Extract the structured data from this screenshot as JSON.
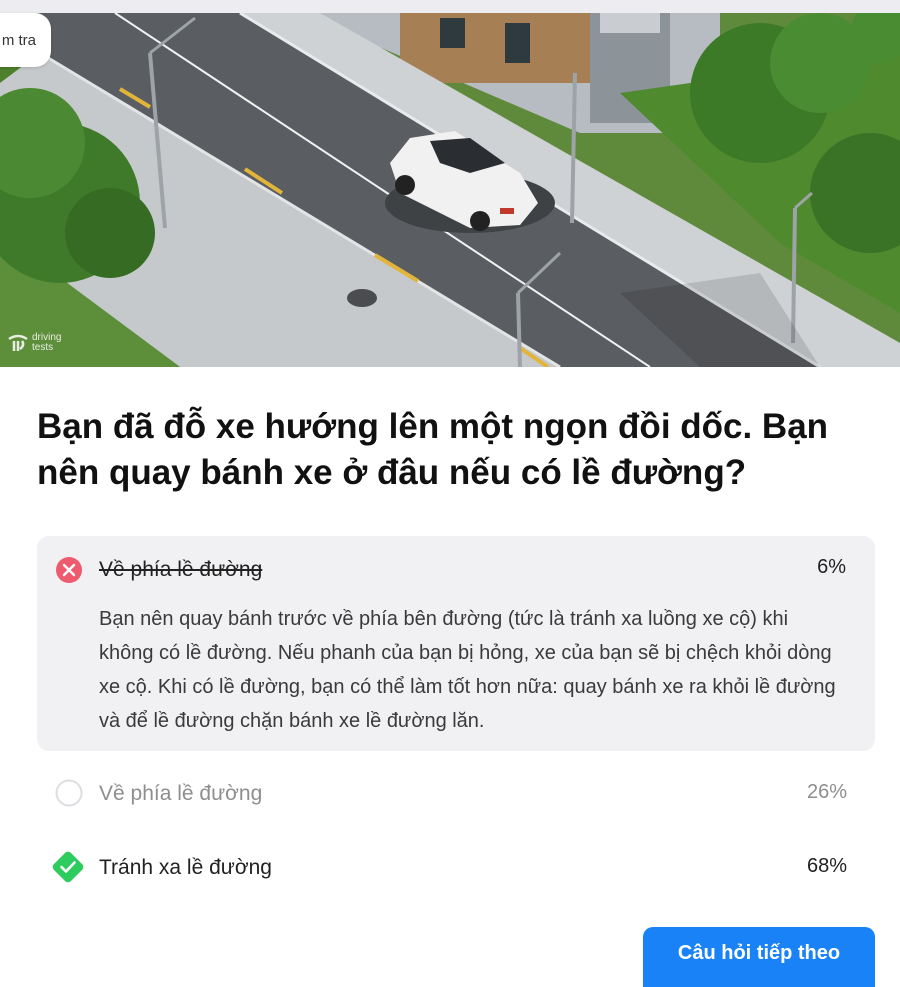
{
  "hero": {
    "tag_text": "m tra",
    "watermark_line1": "driving",
    "watermark_line2": "tests"
  },
  "question": {
    "text": "Bạn đã đỗ xe hướng lên một ngọn đồi dốc. Bạn nên quay bánh xe ở đâu nếu có lề đường?"
  },
  "answers": [
    {
      "label": "Về phía lề đường",
      "percent": "6%",
      "state": "selected-wrong",
      "explanation": "Bạn nên quay bánh trước về phía bên đường (tức là tránh xa luồng xe cộ) khi không có lề đường. Nếu phanh của bạn bị hỏng, xe của bạn sẽ bị chệch khỏi dòng xe cộ. Khi có lề đường, bạn có thể làm tốt hơn nữa: quay bánh xe ra khỏi lề đường và để lề đường chặn bánh xe lề đường lăn."
    },
    {
      "label": "Về phía lề đường",
      "percent": "26%",
      "state": "neutral"
    },
    {
      "label": "Tránh xa lề đường",
      "percent": "68%",
      "state": "correct"
    }
  ],
  "next_button": {
    "label": "Câu hỏi tiếp theo"
  },
  "colors": {
    "wrong": "#ee5a6e",
    "correct": "#2ecc5f",
    "button": "#1a82f7",
    "answer_bg": "#f1f1f4"
  }
}
